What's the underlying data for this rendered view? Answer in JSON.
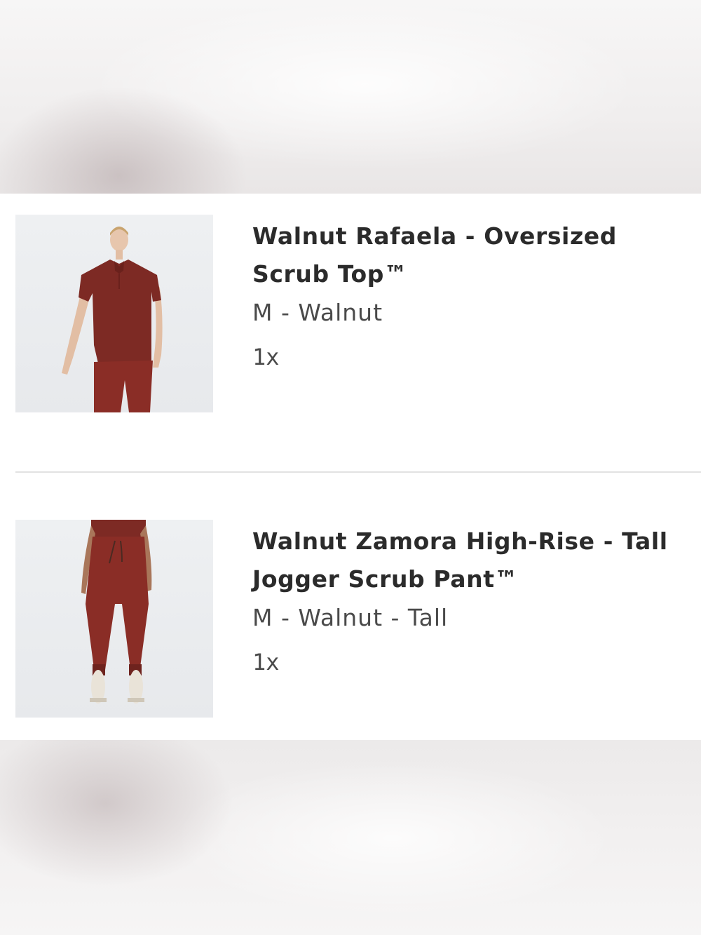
{
  "order": {
    "items": [
      {
        "title_line1": "Walnut Rafaela - Oversized",
        "title_line2": "Scrub Top™",
        "variant": "M - Walnut",
        "quantity": "1x",
        "image": "product-photo-scrub-top"
      },
      {
        "title_line1": "Walnut Zamora High-Rise - Tall",
        "title_line2": "Jogger Scrub Pant™",
        "variant": "M - Walnut - Tall",
        "quantity": "1x",
        "image": "product-photo-jogger-pant"
      }
    ]
  },
  "colors": {
    "product_walnut": "#7d2a24",
    "text_primary": "#2b2b2b",
    "text_secondary": "#4a4a4a",
    "divider": "#e2e2e2"
  }
}
